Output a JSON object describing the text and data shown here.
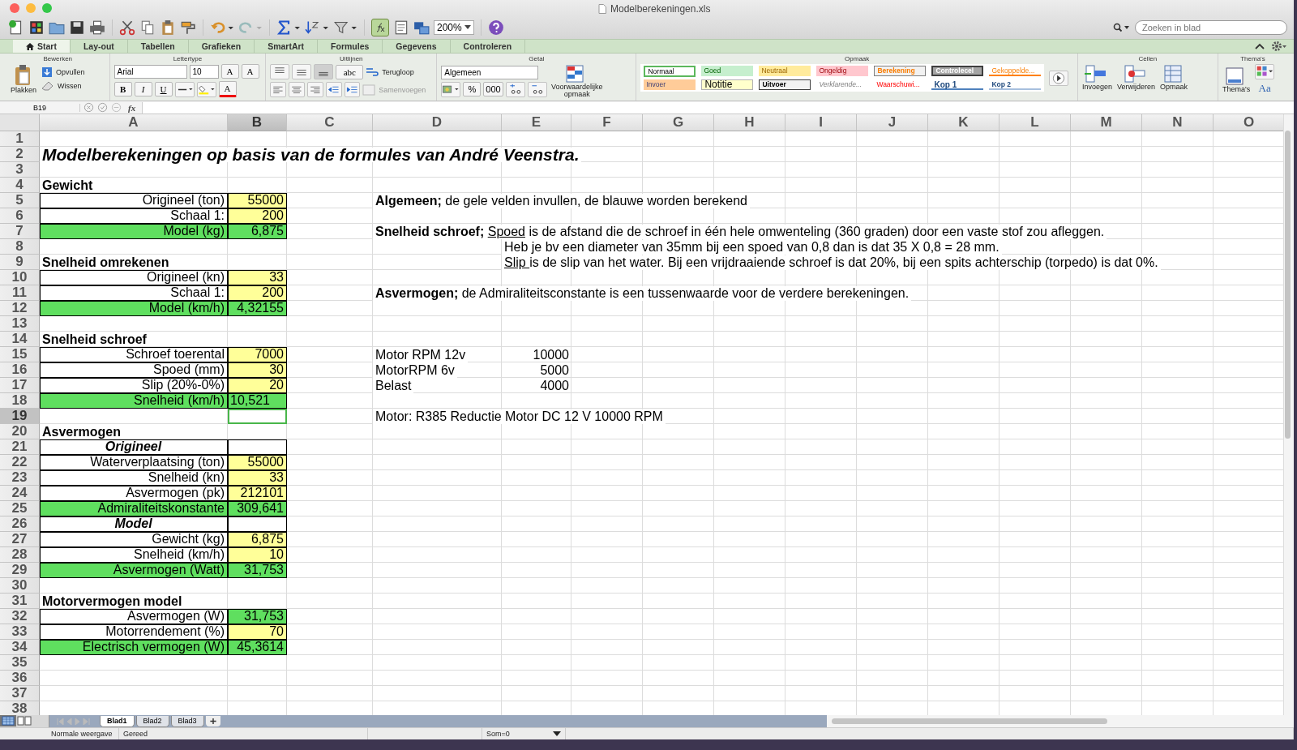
{
  "window": {
    "title": "Modelberekeningen.xls"
  },
  "toolbar": {
    "zoom": "200%",
    "search": {
      "placeholder": "Zoeken in blad"
    }
  },
  "ribbon": {
    "tabs": [
      {
        "label": "Start",
        "selected": true
      },
      {
        "label": "Lay-out",
        "selected": false
      },
      {
        "label": "Tabellen",
        "selected": false
      },
      {
        "label": "Grafieken",
        "selected": false
      },
      {
        "label": "SmartArt",
        "selected": false
      },
      {
        "label": "Formules",
        "selected": false
      },
      {
        "label": "Gegevens",
        "selected": false
      },
      {
        "label": "Controleren",
        "selected": false
      }
    ],
    "bewerken": {
      "title": "Bewerken",
      "paste": "Plakken",
      "fill": "Opvullen",
      "clear": "Wissen"
    },
    "lettertype": {
      "title": "Lettertype",
      "font": "Arial",
      "size": "10",
      "grow": "A",
      "shrink": "A",
      "bold": "B",
      "italic": "I",
      "underline": "U",
      "font_color": "A"
    },
    "uitlijnen": {
      "title": "Uitlijnen",
      "orientation": "abc",
      "wrap": "Terugloop",
      "merge": "Samenvoegen"
    },
    "getal": {
      "title": "Getal",
      "format": "Algemeen",
      "percent": "%",
      "thousands": "000",
      "conditional": "Voorwaardelijke opmaak"
    },
    "opmaak": {
      "title": "Opmaak",
      "styles": [
        {
          "label": "Normaal",
          "kind": "normaal"
        },
        {
          "label": "Goed",
          "kind": "goed"
        },
        {
          "label": "Neutraal",
          "kind": "neutraal"
        },
        {
          "label": "Ongeldig",
          "kind": "ongeldig"
        },
        {
          "label": "Berekening",
          "kind": "berekening"
        },
        {
          "label": "Controlecel",
          "kind": "controlecel"
        },
        {
          "label": "Gekoppelde...",
          "kind": "gekoppeld"
        },
        {
          "label": "Invoer",
          "kind": "invoer"
        },
        {
          "label": "Notitie",
          "kind": "notitie"
        },
        {
          "label": "Uitvoer",
          "kind": "uitvoer"
        },
        {
          "label": "Verklarende...",
          "kind": "verklarend"
        },
        {
          "label": "Waarschuwi...",
          "kind": "waarschuwing"
        },
        {
          "label": "Kop 1",
          "kind": "kop1"
        },
        {
          "label": "Kop 2",
          "kind": "kop2"
        }
      ]
    },
    "cellen": {
      "title": "Cellen",
      "insert": "Invoegen",
      "delete": "Verwijderen",
      "format": "Opmaak"
    },
    "themas": {
      "title": "Thema's",
      "button": "Thema's",
      "fonts": "Aa"
    }
  },
  "formula_bar": {
    "name_box": "B19",
    "fx": "fx"
  },
  "columns": [
    {
      "label": "A",
      "selected": false
    },
    {
      "label": "B",
      "selected": true
    },
    {
      "label": "C",
      "selected": false
    },
    {
      "label": "D",
      "selected": false
    },
    {
      "label": "E",
      "selected": false
    },
    {
      "label": "F",
      "selected": false
    },
    {
      "label": "G",
      "selected": false
    },
    {
      "label": "H",
      "selected": false
    },
    {
      "label": "I",
      "selected": false
    },
    {
      "label": "J",
      "selected": false
    },
    {
      "label": "K",
      "selected": false
    },
    {
      "label": "L",
      "selected": false
    },
    {
      "label": "M",
      "selected": false
    },
    {
      "label": "N",
      "selected": false
    },
    {
      "label": "O",
      "selected": false
    }
  ],
  "rows": [
    {
      "number": "1",
      "selected": false
    },
    {
      "number": "2",
      "selected": false,
      "a": {
        "text": "Modelberekeningen op basis van de formules van André Veenstra.",
        "kind": "title"
      }
    },
    {
      "number": "3",
      "selected": false
    },
    {
      "number": "4",
      "selected": false,
      "a": {
        "text": "Gewicht",
        "kind": "heading"
      }
    },
    {
      "number": "5",
      "selected": false,
      "a": {
        "text": "Origineel (ton)",
        "kind": "label"
      },
      "b": {
        "text": "55000",
        "kind": "number",
        "color": "#ffff99"
      },
      "d": [
        {
          "text": "Algemeen;",
          "kind": "bold"
        },
        {
          "text": " de gele velden invullen, de blauwe worden berekend",
          "kind": "plain"
        }
      ]
    },
    {
      "number": "6",
      "selected": false,
      "a": {
        "text": "Schaal 1:",
        "kind": "label"
      },
      "b": {
        "text": "200",
        "kind": "number",
        "color": "#ffff99"
      }
    },
    {
      "number": "7",
      "selected": false,
      "a": {
        "text": "Model (kg)",
        "kind": "label",
        "color": "#5fdf5f"
      },
      "b": {
        "text": "6,875",
        "kind": "number",
        "color": "#5fdf5f"
      },
      "d": [
        {
          "text": "Snelheid schroef; ",
          "kind": "bold"
        },
        {
          "text": "Spoed",
          "kind": "underline"
        },
        {
          "text": " is de afstand die de schroef in één hele omwenteling (360 graden) door een vaste stof zou afleggen.",
          "kind": "plain"
        }
      ]
    },
    {
      "number": "8",
      "selected": false,
      "e": [
        {
          "text": "Heb je bv een diameter van 35mm bij een spoed van 0,8 dan is dat 35 X 0,8 = 28 mm.",
          "kind": "plain"
        }
      ]
    },
    {
      "number": "9",
      "selected": false,
      "a": {
        "text": "Snelheid omrekenen",
        "kind": "heading"
      },
      "e": [
        {
          "text": "Slip ",
          "kind": "underline"
        },
        {
          "text": "is de slip van het water. Bij een vrijdraaiende schroef is dat 20%, bij een spits achterschip (torpedo) is dat 0%.",
          "kind": "plain"
        }
      ]
    },
    {
      "number": "10",
      "selected": false,
      "a": {
        "text": "Origineel (kn)",
        "kind": "label"
      },
      "b": {
        "text": "33",
        "kind": "number",
        "color": "#ffff99"
      }
    },
    {
      "number": "11",
      "selected": false,
      "a": {
        "text": "Schaal 1:",
        "kind": "label"
      },
      "b": {
        "text": "200",
        "kind": "number",
        "color": "#ffff99"
      },
      "d": [
        {
          "text": "Asvermogen;",
          "kind": "bold"
        },
        {
          "text": " de Admiraliteitsconstante is een tussenwaarde voor de verdere berekeningen.",
          "kind": "plain"
        }
      ]
    },
    {
      "number": "12",
      "selected": false,
      "a": {
        "text": "Model (km/h)",
        "kind": "label",
        "color": "#5fdf5f"
      },
      "b": {
        "text": "4,32155",
        "kind": "number",
        "color": "#5fdf5f"
      }
    },
    {
      "number": "13",
      "selected": false
    },
    {
      "number": "14",
      "selected": false,
      "a": {
        "text": "Snelheid schroef",
        "kind": "heading"
      }
    },
    {
      "number": "15",
      "selected": false,
      "a": {
        "text": "Schroef toerental",
        "kind": "label"
      },
      "b": {
        "text": "7000",
        "kind": "number",
        "color": "#ffff99"
      },
      "d": [
        {
          "text": "Motor RPM 12v",
          "kind": "plain"
        }
      ],
      "e_value": "10000"
    },
    {
      "number": "16",
      "selected": false,
      "a": {
        "text": "Spoed (mm)",
        "kind": "label"
      },
      "b": {
        "text": "30",
        "kind": "number",
        "color": "#ffff99"
      },
      "d": [
        {
          "text": "MotorRPM 6v",
          "kind": "plain"
        }
      ],
      "e_value": "5000"
    },
    {
      "number": "17",
      "selected": false,
      "a": {
        "text": "Slip (20%-0%)",
        "kind": "label"
      },
      "b": {
        "text": "20",
        "kind": "number",
        "color": "#ffff99"
      },
      "d": [
        {
          "text": "Belast",
          "kind": "plain"
        }
      ],
      "e_value": "4000"
    },
    {
      "number": "18",
      "selected": false,
      "a": {
        "text": "Snelheid (km/h)",
        "kind": "label",
        "color": "#5fdf5f"
      },
      "b": {
        "text": "10,521",
        "kind": "text",
        "color": "#5fdf5f"
      }
    },
    {
      "number": "19",
      "selected": true,
      "d": [
        {
          "text": "Motor: R385 Reductie Motor DC 12 V 10000 RPM",
          "kind": "plain"
        }
      ]
    },
    {
      "number": "20",
      "selected": false,
      "a": {
        "text": "Asvermogen",
        "kind": "heading"
      }
    },
    {
      "number": "21",
      "selected": false,
      "a": {
        "text": "Origineel",
        "kind": "subheading"
      }
    },
    {
      "number": "22",
      "selected": false,
      "a": {
        "text": "Waterverplaatsing (ton)",
        "kind": "label"
      },
      "b": {
        "text": "55000",
        "kind": "number",
        "color": "#ffff99"
      }
    },
    {
      "number": "23",
      "selected": false,
      "a": {
        "text": "Snelheid (kn)",
        "kind": "label"
      },
      "b": {
        "text": "33",
        "kind": "number",
        "color": "#ffff99"
      }
    },
    {
      "number": "24",
      "selected": false,
      "a": {
        "text": "Asvermogen (pk)",
        "kind": "label"
      },
      "b": {
        "text": "212101",
        "kind": "number",
        "color": "#ffff99"
      }
    },
    {
      "number": "25",
      "selected": false,
      "a": {
        "text": "Admiraliteitskonstante",
        "kind": "label",
        "color": "#5fdf5f"
      },
      "b": {
        "text": "309,641",
        "kind": "number",
        "color": "#5fdf5f"
      }
    },
    {
      "number": "26",
      "selected": false,
      "a": {
        "text": "Model",
        "kind": "subheading"
      }
    },
    {
      "number": "27",
      "selected": false,
      "a": {
        "text": "Gewicht (kg)",
        "kind": "label"
      },
      "b": {
        "text": "6,875",
        "kind": "number",
        "color": "#ffff99"
      }
    },
    {
      "number": "28",
      "selected": false,
      "a": {
        "text": "Snelheid (km/h)",
        "kind": "label"
      },
      "b": {
        "text": "10",
        "kind": "number",
        "color": "#ffff99"
      }
    },
    {
      "number": "29",
      "selected": false,
      "a": {
        "text": "Asvermogen (Watt)",
        "kind": "label",
        "color": "#5fdf5f"
      },
      "b": {
        "text": "31,753",
        "kind": "number",
        "color": "#5fdf5f"
      }
    },
    {
      "number": "30",
      "selected": false
    },
    {
      "number": "31",
      "selected": false,
      "a": {
        "text": "Motorvermogen model",
        "kind": "heading"
      }
    },
    {
      "number": "32",
      "selected": false,
      "a": {
        "text": "Asvermogen (W)",
        "kind": "label"
      },
      "b": {
        "text": "31,753",
        "kind": "number",
        "color": "#5fdf5f"
      }
    },
    {
      "number": "33",
      "selected": false,
      "a": {
        "text": "Motorrendement (%)",
        "kind": "label"
      },
      "b": {
        "text": "70",
        "kind": "number",
        "color": "#ffff99"
      }
    },
    {
      "number": "34",
      "selected": false,
      "a": {
        "text": "Electrisch vermogen (W)",
        "kind": "label",
        "color": "#5fdf5f"
      },
      "b": {
        "text": "45,3614",
        "kind": "number",
        "color": "#5fdf5f"
      }
    },
    {
      "number": "35",
      "selected": false
    },
    {
      "number": "36",
      "selected": false
    },
    {
      "number": "37",
      "selected": false
    },
    {
      "number": "38",
      "selected": false
    }
  ],
  "sheet_tabs": [
    {
      "label": "Blad1",
      "selected": true
    },
    {
      "label": "Blad2",
      "selected": false
    },
    {
      "label": "Blad3",
      "selected": false
    }
  ],
  "status_bar": {
    "view": "Normale weergave",
    "state": "Gereed",
    "sum": "Som=0"
  }
}
